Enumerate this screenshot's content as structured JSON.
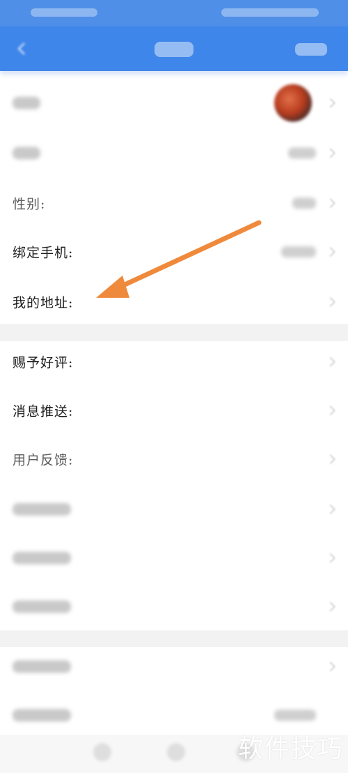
{
  "colors": {
    "status_bar": "#4f8fe8",
    "nav_bar": "#3f86ea",
    "arrow": "#ef8a3c",
    "separator": "#f2f2f2"
  },
  "nav": {
    "back_icon": "back-arrow-icon"
  },
  "settings": {
    "gender_label": "性别:",
    "bind_phone_label": "绑定手机:",
    "my_address_label": "我的地址:",
    "rate_label": "赐予好评:",
    "push_label": "消息推送:",
    "feedback_label": "用户反馈:"
  },
  "annotation": {
    "arrow_icon": "pointer-arrow-icon"
  },
  "watermark": "软件技巧"
}
